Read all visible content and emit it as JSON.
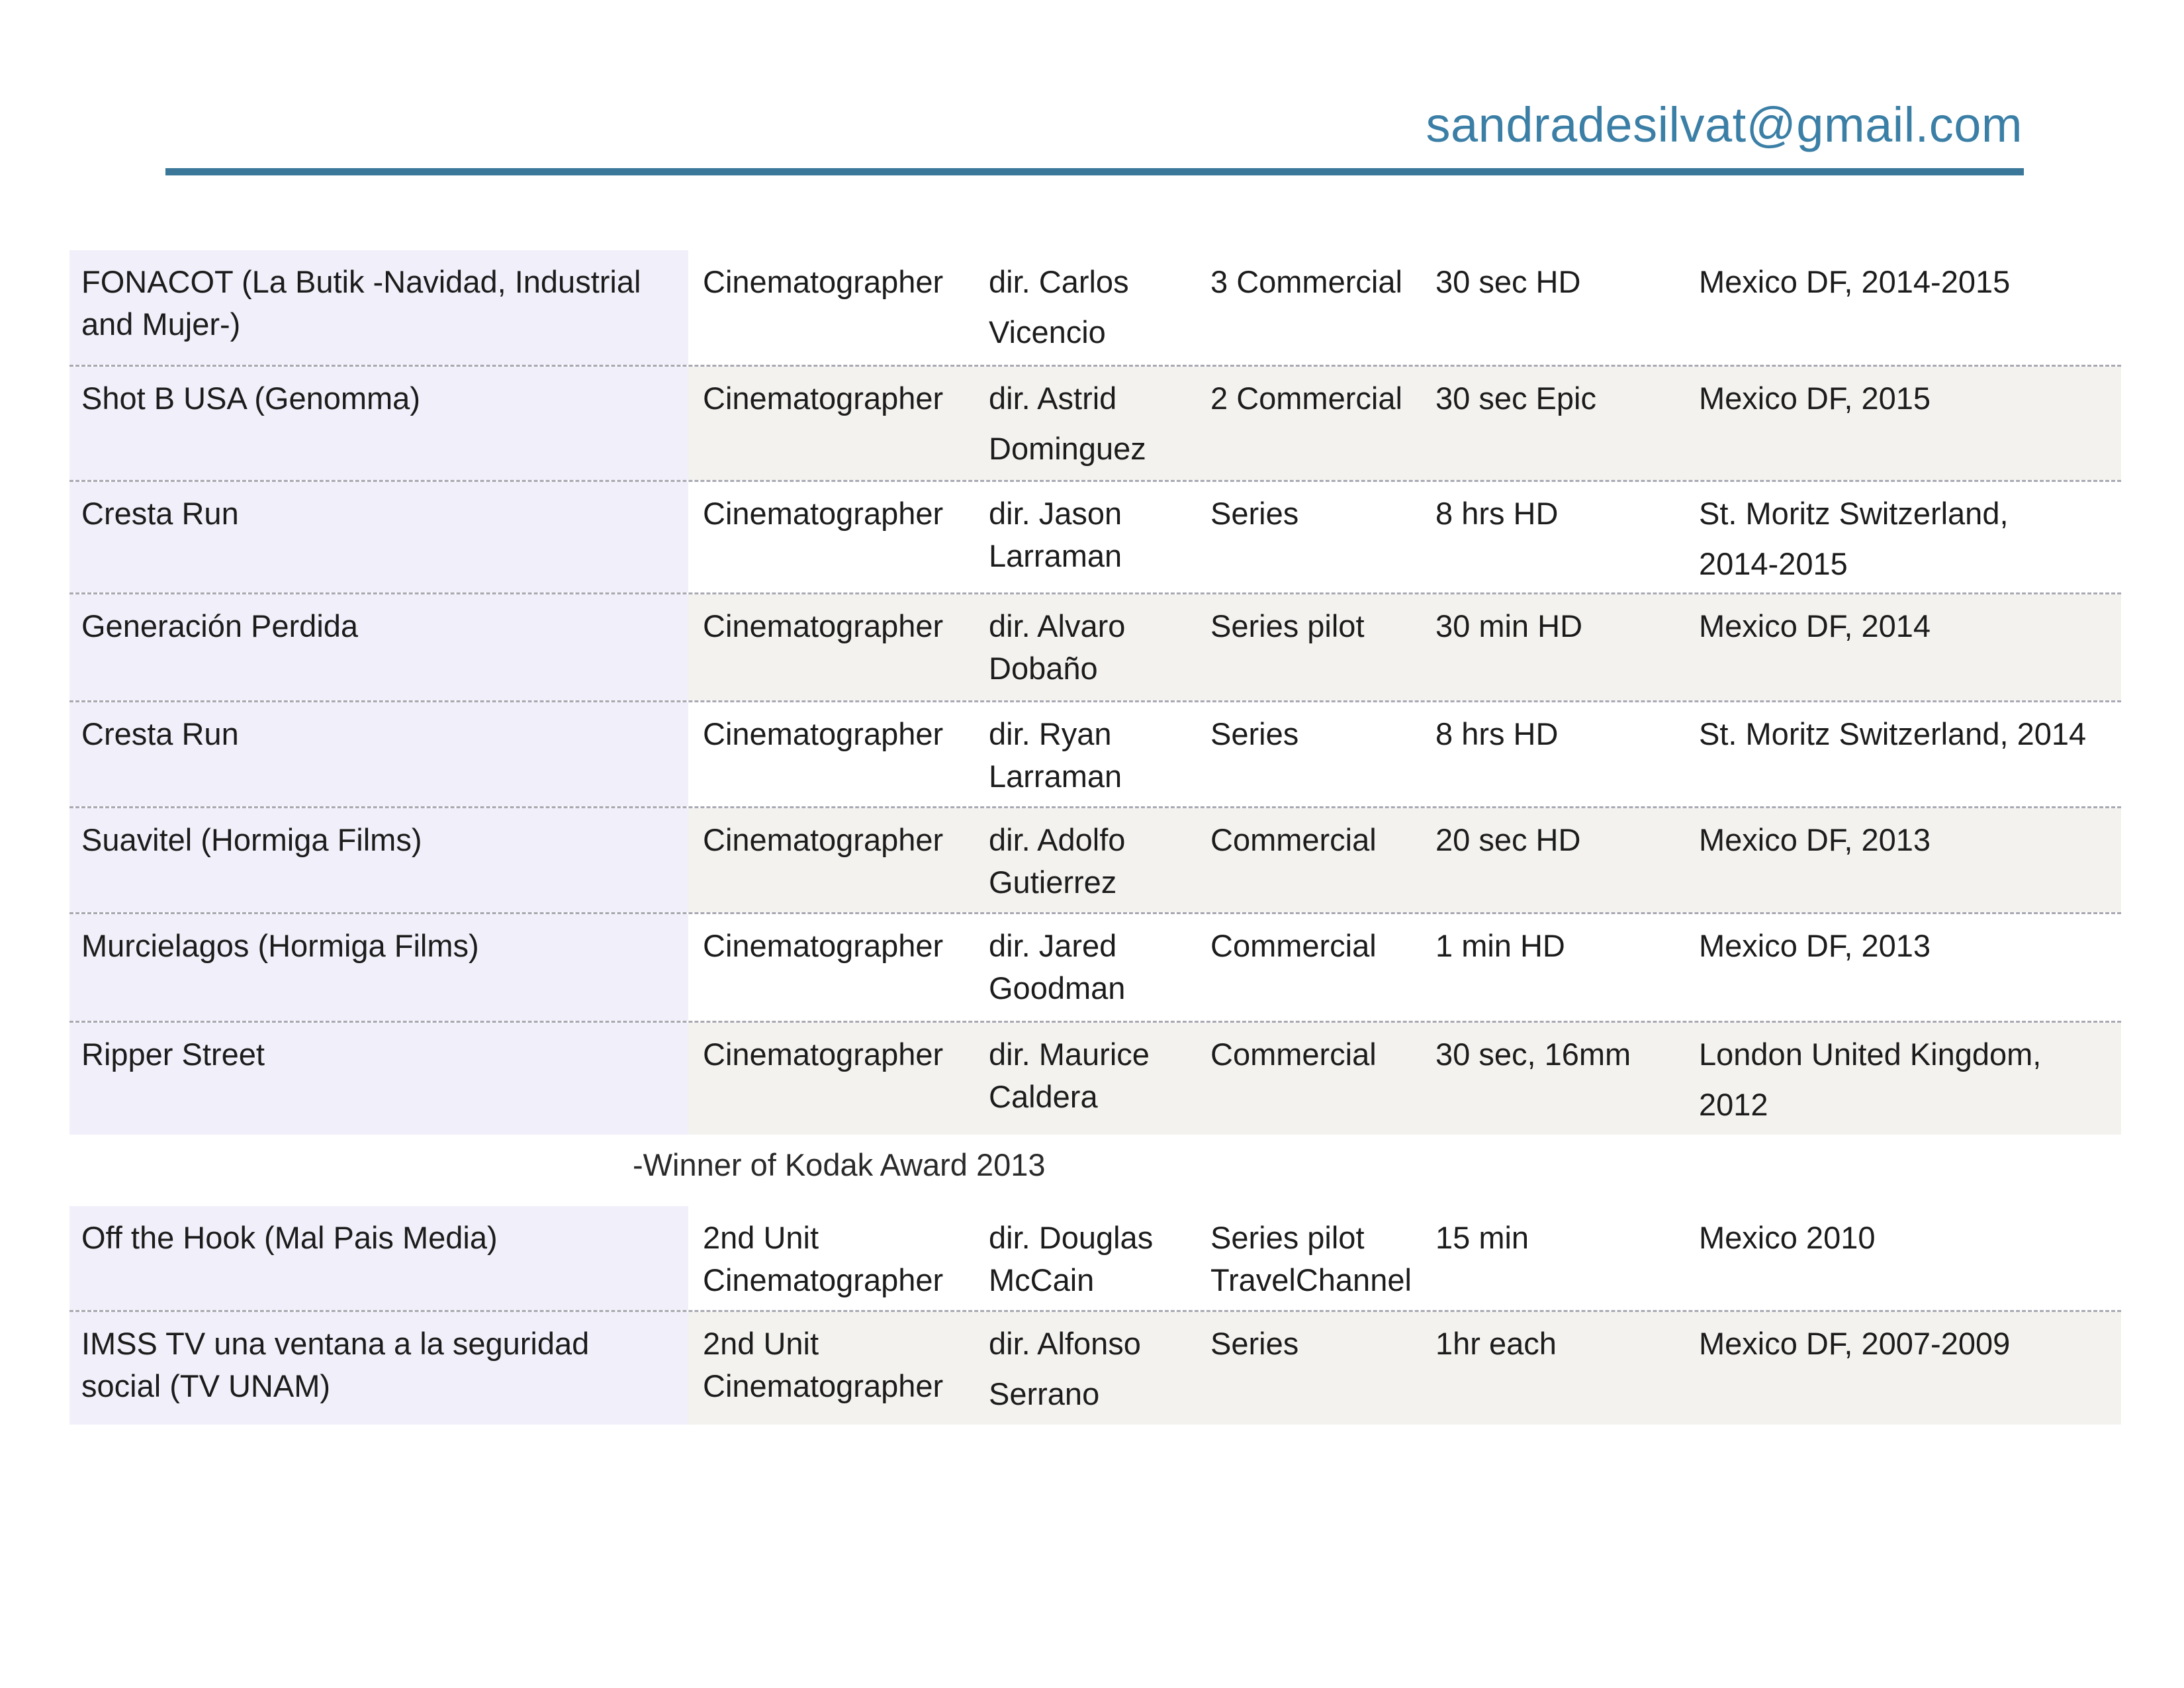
{
  "header": {
    "email": "sandradesilvat@gmail.com"
  },
  "credits_block_1": [
    {
      "title": "FONACOT (La Butik -Navidad, Industrial\nand Mujer-)",
      "role": "Cinematographer",
      "director": "dir. Carlos\nVicencio",
      "type": "3 Commercial",
      "duration": "30 sec HD",
      "location": "Mexico DF, 2014-2015"
    },
    {
      "title": "Shot B USA (Genomma)",
      "role": "Cinematographer",
      "director": "dir. Astrid\nDominguez",
      "type": "2 Commercial",
      "duration": "30 sec Epic",
      "location": "Mexico DF, 2015"
    },
    {
      "title": "Cresta Run",
      "role": "Cinematographer",
      "director": "dir. Jason\nLarraman",
      "type": "Series",
      "duration": "8 hrs HD",
      "location": "St. Moritz Switzerland,\n2014-2015"
    },
    {
      "title": "Generación Perdida",
      "role": "Cinematographer",
      "director": "dir. Alvaro\nDobaño",
      "type": "Series pilot",
      "duration": "30 min HD",
      "location": "Mexico DF, 2014"
    },
    {
      "title": "Cresta Run",
      "role": "Cinematographer",
      "director": "dir. Ryan\nLarraman",
      "type": "Series",
      "duration": "8 hrs HD",
      "location": "St. Moritz Switzerland, 2014"
    },
    {
      "title": "Suavitel (Hormiga Films)",
      "role": "Cinematographer",
      "director": "dir. Adolfo\nGutierrez",
      "type": "Commercial",
      "duration": "20 sec HD",
      "location": "Mexico DF, 2013"
    },
    {
      "title": "Murcielagos (Hormiga Films)",
      "role": "Cinematographer",
      "director": "dir. Jared\nGoodman",
      "type": "Commercial",
      "duration": "1 min HD",
      "location": "Mexico DF, 2013"
    },
    {
      "title": "Ripper Street",
      "role": "Cinematographer",
      "director": "dir. Maurice\nCaldera",
      "type": "Commercial",
      "duration": "30 sec, 16mm",
      "location": "London United Kingdom,\n2012"
    }
  ],
  "award_note": "-Winner of Kodak Award 2013",
  "credits_block_2": [
    {
      "title": "Off the Hook (Mal Pais Media)",
      "role": "2nd Unit\nCinematographer",
      "director": "dir. Douglas\nMcCain",
      "type": "Series pilot\nTravelChannel",
      "duration": "15 min",
      "location": "Mexico 2010"
    },
    {
      "title": "IMSS TV una ventana a la seguridad\nsocial (TV UNAM)",
      "role": "2nd Unit\nCinematographer",
      "director": "dir. Alfonso\nSerrano",
      "type": "Series",
      "duration": "1hr each",
      "location": "Mexico DF, 2007-2009"
    }
  ]
}
